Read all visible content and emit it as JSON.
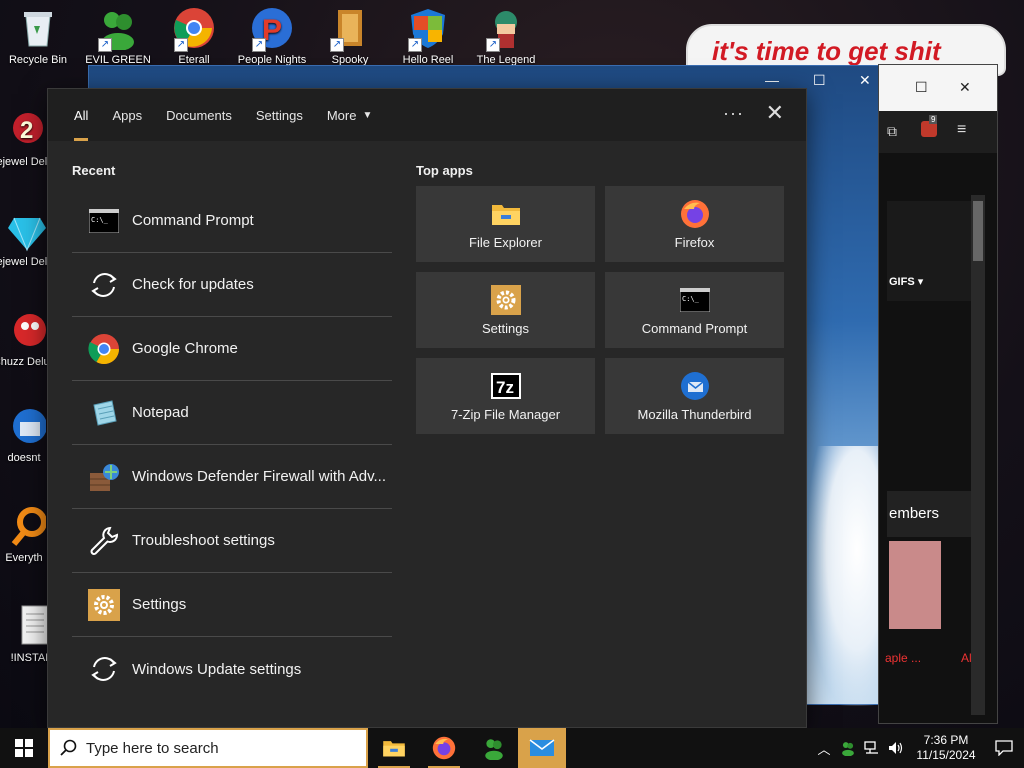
{
  "desktop": {
    "icons": [
      {
        "label": "Recycle Bin"
      },
      {
        "label": "EVIL GREEN"
      },
      {
        "label": "Eterall"
      },
      {
        "label": "People Nights"
      },
      {
        "label": "Spooky"
      },
      {
        "label": "Hello Reel"
      },
      {
        "label": "The Legend"
      },
      {
        "label": "Bejewel Delux"
      },
      {
        "label": "Bejewel Delux"
      },
      {
        "label": "Chuzz Delux"
      },
      {
        "label": "doesnt"
      },
      {
        "label": "Everyth"
      },
      {
        "label": "!INSTALL"
      }
    ],
    "bubble_text": "it's time to get shit"
  },
  "browser_fragments": {
    "badge_count": "9",
    "gifs_label": "GIFS",
    "members_label": "embers",
    "people_label": "aple ...",
    "al_label": "Al"
  },
  "panel": {
    "tabs": [
      {
        "label": "All",
        "active": true
      },
      {
        "label": "Apps"
      },
      {
        "label": "Documents"
      },
      {
        "label": "Settings"
      },
      {
        "label": "More"
      }
    ],
    "ellipsis": "···",
    "close_glyph": "✕",
    "recent_title": "Recent",
    "recent": [
      {
        "label": "Command Prompt",
        "icon": "command-prompt-icon"
      },
      {
        "label": "Check for updates",
        "icon": "refresh-icon"
      },
      {
        "label": "Google Chrome",
        "icon": "chrome-icon"
      },
      {
        "label": "Notepad",
        "icon": "notepad-icon"
      },
      {
        "label": "Windows Defender Firewall with Adv...",
        "icon": "firewall-icon"
      },
      {
        "label": "Troubleshoot settings",
        "icon": "wrench-icon"
      },
      {
        "label": "Settings",
        "icon": "gear-icon"
      },
      {
        "label": "Windows Update settings",
        "icon": "refresh-icon"
      }
    ],
    "top_apps_title": "Top apps",
    "top_apps": [
      {
        "label": "File Explorer",
        "icon": "folder-icon"
      },
      {
        "label": "Firefox",
        "icon": "firefox-icon"
      },
      {
        "label": "Settings",
        "icon": "gear-icon"
      },
      {
        "label": "Command Prompt",
        "icon": "command-prompt-icon"
      },
      {
        "label": "7-Zip File Manager",
        "icon": "7zip-icon"
      },
      {
        "label": "Mozilla Thunderbird",
        "icon": "thunderbird-icon"
      }
    ]
  },
  "taskbar": {
    "search_placeholder": "Type here to search",
    "clock_time": "7:36 PM",
    "clock_date": "11/15/2024"
  },
  "colors": {
    "accent": "#d9a24a",
    "panel_bg": "#272727",
    "tile_bg": "#383838"
  }
}
